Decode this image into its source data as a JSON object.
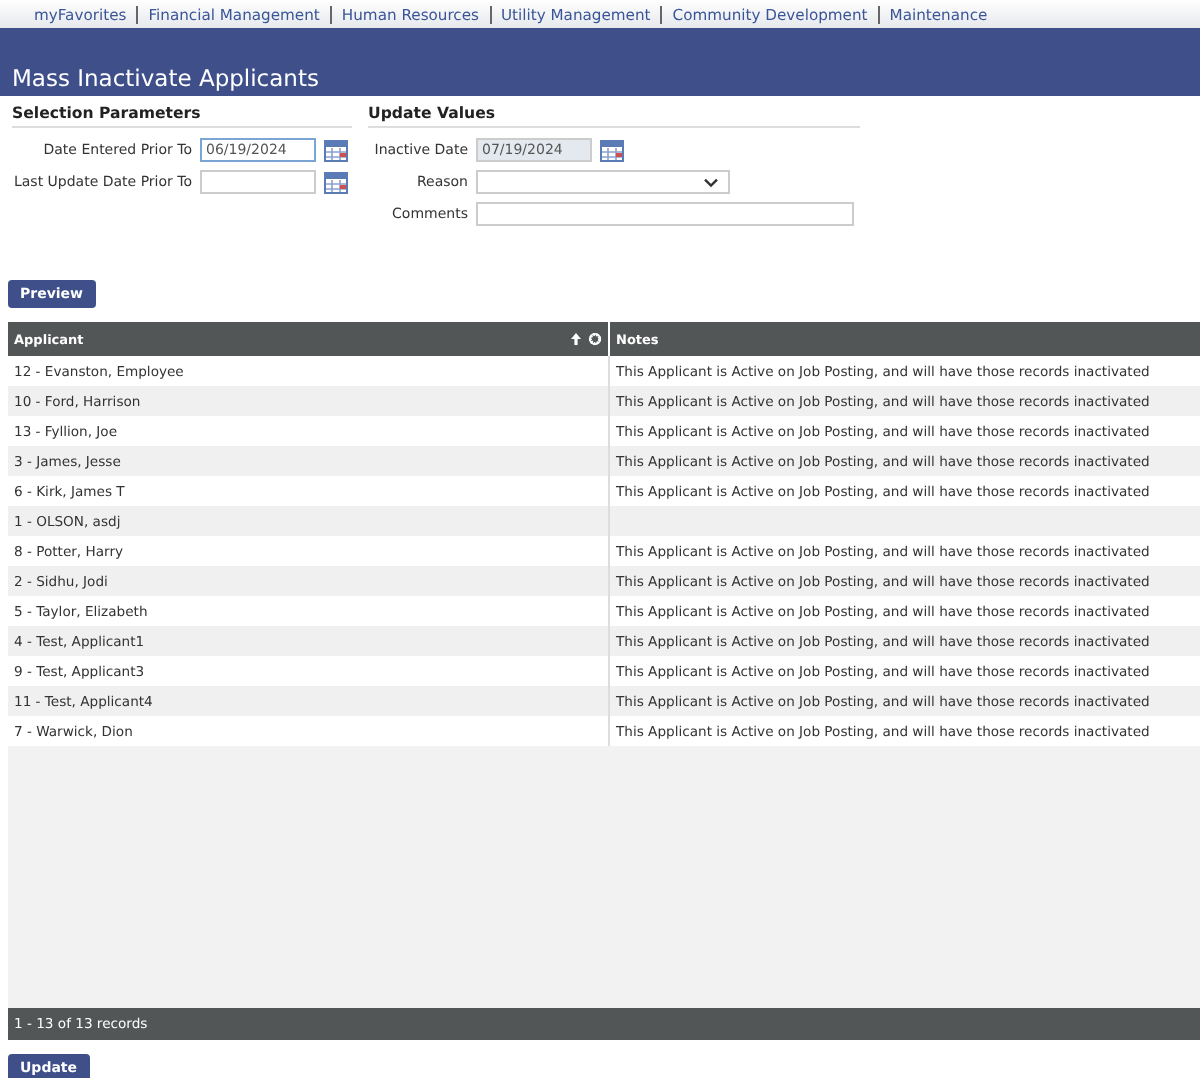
{
  "nav": [
    "myFavorites",
    "Financial Management",
    "Human Resources",
    "Utility Management",
    "Community Development",
    "Maintenance"
  ],
  "page_title": "Mass Inactivate Applicants",
  "selection_parameters": {
    "heading": "Selection Parameters",
    "fields": [
      {
        "label": "Date Entered Prior To",
        "value": "06/19/2024",
        "focused": true
      },
      {
        "label": "Last Update Date Prior To",
        "focused": false
      }
    ]
  },
  "update_values": {
    "heading": "Update Values",
    "fields": [
      {
        "kind": "date",
        "label": "Inactive Date",
        "value": "07/19/2024",
        "disabled": true
      },
      {
        "kind": "select",
        "label": "Reason",
        "disabled": false
      },
      {
        "kind": "text",
        "label": "Comments",
        "disabled": false
      }
    ]
  },
  "preview_button": "Preview",
  "table": {
    "columns": [
      "Applicant",
      "Notes"
    ],
    "rows": [
      {
        "applicant": "12 - Evanston, Employee",
        "notes": "This Applicant is Active on Job Posting, and will have those records inactivated"
      },
      {
        "applicant": "10 - Ford, Harrison",
        "notes": "This Applicant is Active on Job Posting, and will have those records inactivated"
      },
      {
        "applicant": "13 - Fyllion, Joe",
        "notes": "This Applicant is Active on Job Posting, and will have those records inactivated"
      },
      {
        "applicant": "3 - James, Jesse",
        "notes": "This Applicant is Active on Job Posting, and will have those records inactivated"
      },
      {
        "applicant": "6 - Kirk, James T",
        "notes": "This Applicant is Active on Job Posting, and will have those records inactivated"
      },
      {
        "applicant": "1 - OLSON, asdj"
      },
      {
        "applicant": "8 - Potter, Harry",
        "notes": "This Applicant is Active on Job Posting, and will have those records inactivated"
      },
      {
        "applicant": "2 - Sidhu, Jodi",
        "notes": "This Applicant is Active on Job Posting, and will have those records inactivated"
      },
      {
        "applicant": "5 - Taylor, Elizabeth",
        "notes": "This Applicant is Active on Job Posting, and will have those records inactivated"
      },
      {
        "applicant": "4 - Test, Applicant1",
        "notes": "This Applicant is Active on Job Posting, and will have those records inactivated"
      },
      {
        "applicant": "9 - Test, Applicant3",
        "notes": "This Applicant is Active on Job Posting, and will have those records inactivated"
      },
      {
        "applicant": "11 - Test, Applicant4",
        "notes": "This Applicant is Active on Job Posting, and will have those records inactivated"
      },
      {
        "applicant": "7 - Warwick, Dion",
        "notes": "This Applicant is Active on Job Posting, and will have those records inactivated"
      }
    ],
    "footer": "1 - 13 of 13 records"
  },
  "update_button": "Update"
}
